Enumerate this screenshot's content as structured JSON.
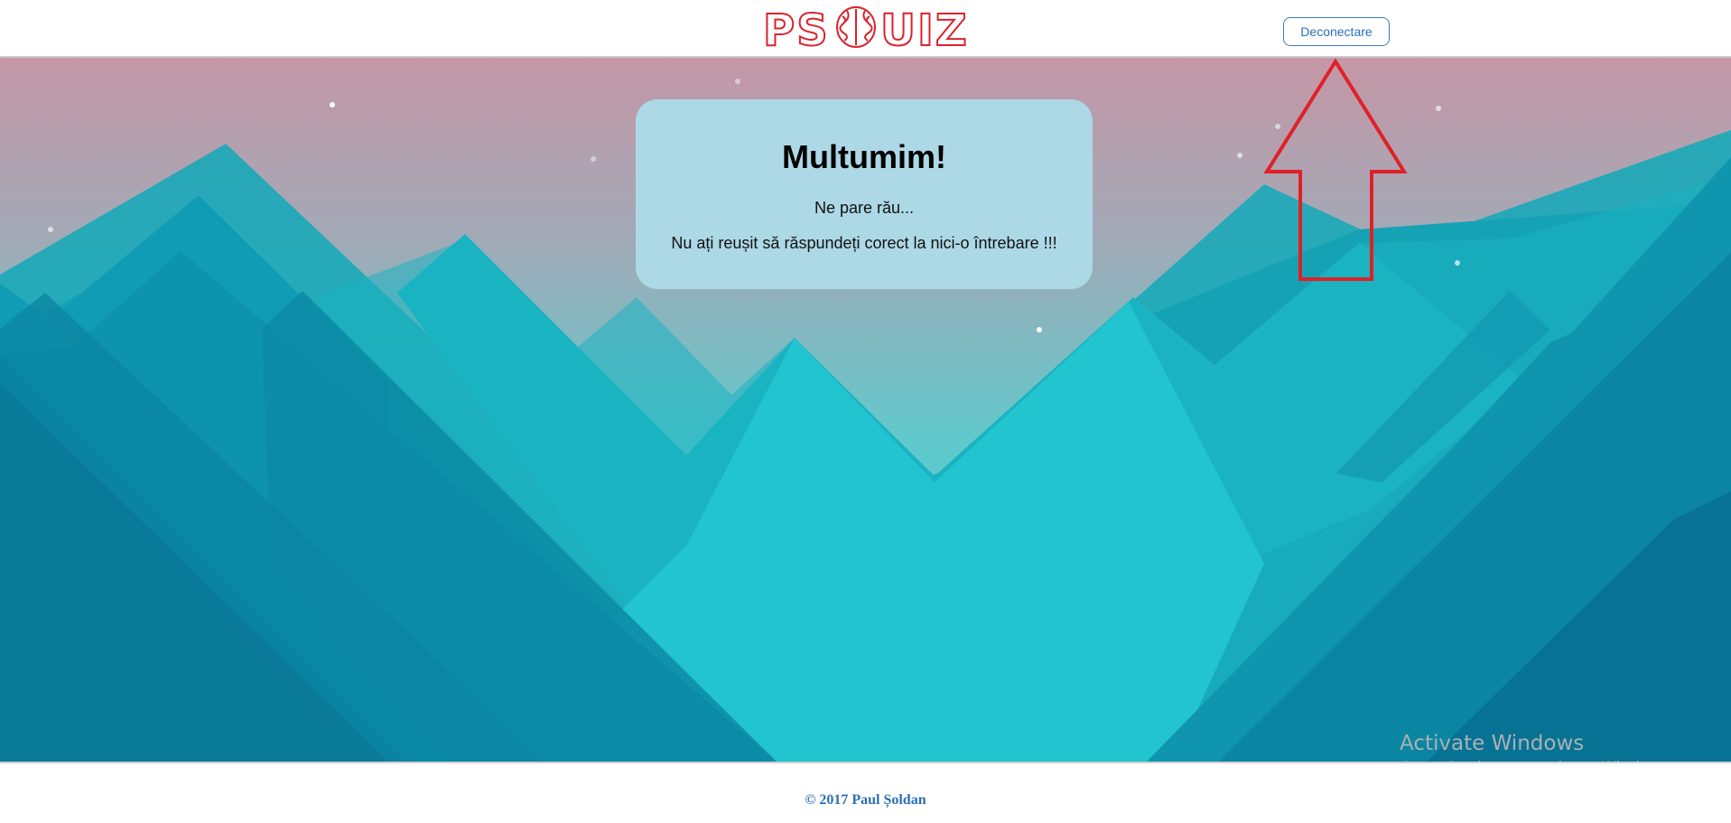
{
  "header": {
    "logo_text": "PS QUIZ",
    "logout_label": "Deconectare"
  },
  "card": {
    "title": "Multumim!",
    "line1": "Ne pare rău...",
    "line2": "Nu ați reușit să răspundeți corect la nici-o întrebare !!!"
  },
  "annotation": {
    "icon": "up-arrow-icon",
    "color": "#e02027"
  },
  "watermark": {
    "title": "Activate Windows",
    "subtitle": "Go to Settings to activate Windows."
  },
  "footer": {
    "copyright": "© 2017 Paul Șoldan"
  },
  "colors": {
    "brand": "#d9232d",
    "link": "#2e6fb3",
    "card_bg": "#add8e6",
    "sky_top": "#c597a6",
    "sky_bottom": "#5fc9cc",
    "mountain_dark": "#0a7f99",
    "mountain_light": "#22c5ce"
  }
}
